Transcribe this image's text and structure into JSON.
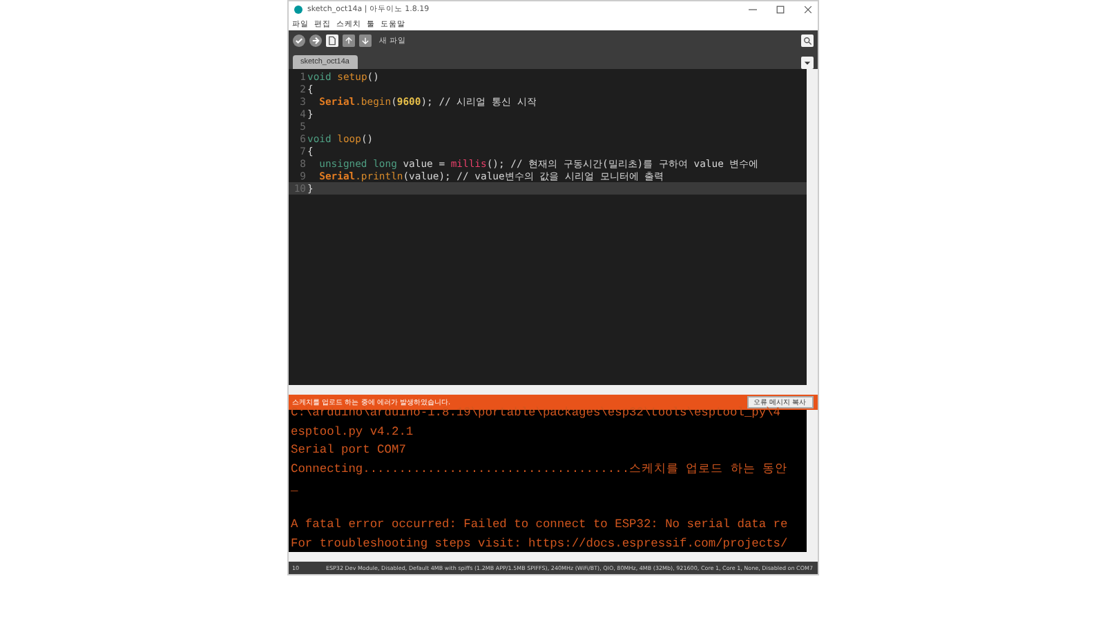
{
  "window": {
    "title": "sketch_oct14a | 아두이노 1.8.19"
  },
  "menu": [
    "파일",
    "편집",
    "스케치",
    "툴",
    "도움말"
  ],
  "toolbar": {
    "hover_label": "새 파일"
  },
  "tabs": [
    {
      "label": "sketch_oct14a",
      "selected": true
    }
  ],
  "editor": {
    "lines": [
      {
        "number": "1",
        "selected": false,
        "tokens": [
          {
            "kind": "keyword",
            "text": "void"
          },
          {
            "kind": "function",
            "text": " setup"
          },
          {
            "kind": "plain",
            "text": "()"
          }
        ]
      },
      {
        "number": "2",
        "selected": false,
        "tokens": [
          {
            "kind": "plain",
            "text": "{"
          }
        ]
      },
      {
        "number": "3",
        "selected": false,
        "indent": true,
        "tokens": [
          {
            "kind": "class",
            "text": "Serial"
          },
          {
            "kind": "function",
            "text": ".begin"
          },
          {
            "kind": "plain",
            "text": "("
          },
          {
            "kind": "number",
            "text": "9600"
          },
          {
            "kind": "plain",
            "text": "); // 시리얼 통신 시작"
          }
        ]
      },
      {
        "number": "4",
        "selected": false,
        "tokens": [
          {
            "kind": "plain",
            "text": "}"
          }
        ]
      },
      {
        "number": "5",
        "selected": false
      },
      {
        "number": "6",
        "selected": false,
        "tokens": [
          {
            "kind": "keyword",
            "text": "void"
          },
          {
            "kind": "function",
            "text": " loop"
          },
          {
            "kind": "plain",
            "text": "()"
          }
        ]
      },
      {
        "number": "7",
        "selected": false,
        "tokens": [
          {
            "kind": "plain",
            "text": "{"
          }
        ]
      },
      {
        "number": "8",
        "selected": false,
        "indent": true,
        "tokens": [
          {
            "kind": "keyword",
            "text": "unsigned long"
          },
          {
            "kind": "plain",
            "text": " value = "
          },
          {
            "kind": "builtin",
            "text": "millis"
          },
          {
            "kind": "plain",
            "text": "(); // 현재의 구동시간(밀리초)를 구하여 value 변수에"
          }
        ]
      },
      {
        "number": "9",
        "selected": false,
        "indent": true,
        "tokens": [
          {
            "kind": "class",
            "text": "Serial"
          },
          {
            "kind": "function",
            "text": ".println"
          },
          {
            "kind": "plain",
            "text": "(value); // value변수의 값을 시리얼 모니터에 출력"
          }
        ]
      },
      {
        "number": "10",
        "selected": true,
        "tokens": [
          {
            "kind": "plain",
            "text": "}"
          }
        ]
      }
    ]
  },
  "notice": {
    "message": "스케치를 업로드 하는 중에 에러가 발생하였습니다.",
    "button": "오류 메시지 복사"
  },
  "console": {
    "lines": [
      {
        "text": "C:\\arduino\\arduino-1.8.19\\portable\\packages\\esp32\\tools\\esptool_py\\4"
      },
      {
        "text": "esptool.py v4.2.1"
      },
      {
        "text": "Serial port COM7"
      },
      {
        "text": "Connecting.....................................스케치를 업로드 하는 동안"
      },
      {
        "text": "_"
      },
      {
        "blank_before": true,
        "text": "A fatal error occurred: Failed to connect to ESP32: No serial data re"
      },
      {
        "text": "For troubleshooting steps visit: https://docs.espressif.com/projects/"
      }
    ]
  },
  "status_bar": {
    "line": "10",
    "board": "ESP32 Dev Module, Disabled, Default 4MB with spiffs (1.2MB APP/1.5MB SPIFFS), 240MHz (WiFi/BT), QIO, 80MHz, 4MB (32Mb), 921600, Core 1, Core 1, None, Disabled on COM7"
  }
}
